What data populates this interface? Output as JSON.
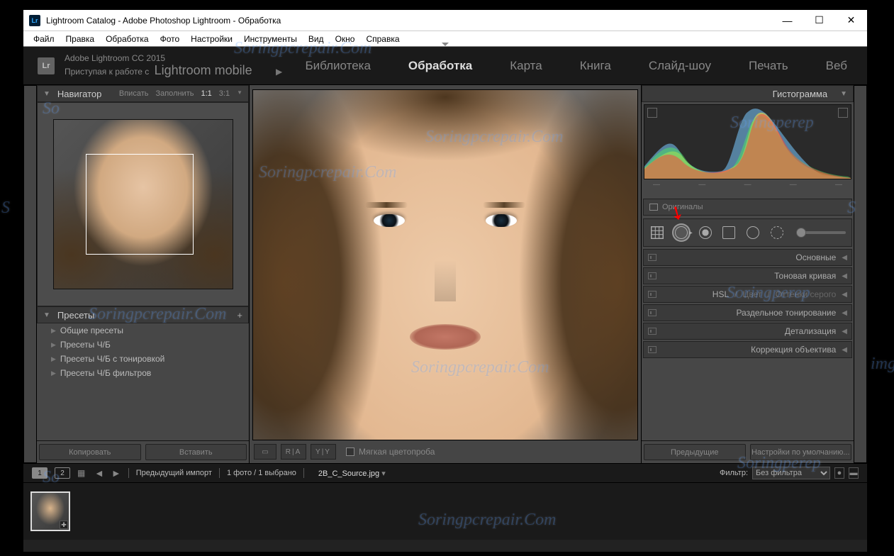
{
  "titlebar": {
    "logo_text": "Lr",
    "title": "Lightroom Catalog - Adobe Photoshop Lightroom - Обработка"
  },
  "menubar": [
    "Файл",
    "Правка",
    "Обработка",
    "Фото",
    "Настройки",
    "Инструменты",
    "Вид",
    "Окно",
    "Справка"
  ],
  "module_bar": {
    "subtitle": "Adobe Lightroom CC 2015",
    "mobile_prefix": "Приступая к работе с",
    "mobile": "Lightroom mobile",
    "tabs": [
      "Библиотека",
      "Обработка",
      "Карта",
      "Книга",
      "Слайд-шоу",
      "Печать",
      "Веб"
    ],
    "active": "Обработка"
  },
  "left": {
    "navigator": {
      "title": "Навигатор",
      "modes": [
        "Вписать",
        "Заполнить",
        "1:1",
        "3:1"
      ],
      "active_mode": "1:1"
    },
    "presets": {
      "title": "Пресеты",
      "items": [
        "Общие пресеты",
        "Пресеты Ч/Б",
        "Пресеты Ч/Б с тонировкой",
        "Пресеты Ч/Б фильтров"
      ]
    },
    "buttons": {
      "copy": "Копировать",
      "paste": "Вставить"
    }
  },
  "center_toolbar": {
    "view_compare": [
      "R|A",
      "Y|Y"
    ],
    "soft_proof": "Мягкая цветопроба"
  },
  "right": {
    "histogram_title": "Гистограмма",
    "original_label": "Оригиналы",
    "histo_values": [
      "—",
      "—",
      "—",
      "—",
      "—"
    ],
    "panels": [
      {
        "label": "Основные"
      },
      {
        "label": "Тоновая кривая"
      },
      {
        "label": "HSL",
        "extra": [
          "Цвет",
          "Оттенки серого"
        ]
      },
      {
        "label": "Раздельное тонирование"
      },
      {
        "label": "Детализация"
      },
      {
        "label": "Коррекция объектива"
      }
    ],
    "buttons": {
      "prev": "Предыдущие",
      "defaults": "Настройки по умолчанию..."
    }
  },
  "info_bar": {
    "views": [
      "1",
      "2"
    ],
    "source": "Предыдущий импорт",
    "count": "1 фото / 1 выбрано",
    "filename": "2B_C_Source.jpg",
    "filter_label": "Фильтр:",
    "filter_value": "Без фильтра"
  },
  "watermark_text": "Soringpcrepair.Com"
}
